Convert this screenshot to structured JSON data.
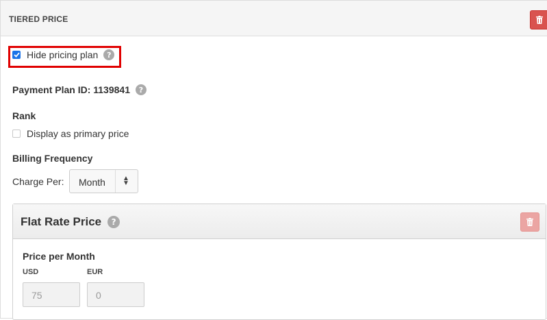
{
  "panel": {
    "title": "TIERED PRICE",
    "delete_icon": "trash-icon"
  },
  "hide_plan": {
    "label": "Hide pricing plan",
    "checked": true,
    "help": "?"
  },
  "payment_plan": {
    "label": "Payment Plan ID: 1139841",
    "help": "?"
  },
  "rank": {
    "heading": "Rank",
    "primary_label": "Display as primary price",
    "checked": false
  },
  "billing": {
    "heading": "Billing Frequency",
    "charge_label": "Charge Per:",
    "charge_value": "Month"
  },
  "flat_rate": {
    "title": "Flat Rate Price",
    "help": "?",
    "delete_icon": "trash-icon",
    "price_heading": "Price per Month",
    "currencies": [
      {
        "code": "USD",
        "value": "75"
      },
      {
        "code": "EUR",
        "value": "0"
      }
    ]
  },
  "colors": {
    "checkbox_accent": "#1a73e8",
    "delete_button": "#d9534f",
    "highlight_border": "#e00000"
  }
}
